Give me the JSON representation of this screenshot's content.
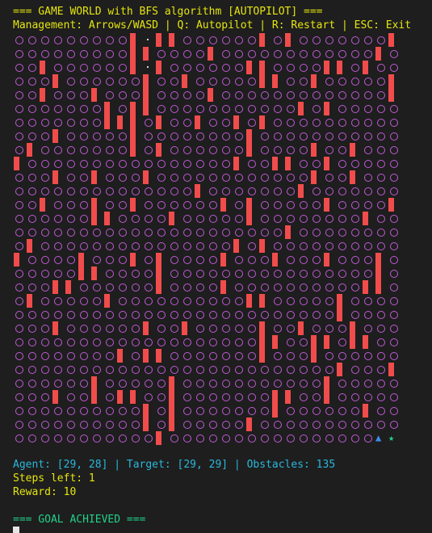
{
  "header": {
    "title": "=== GAME WORLD with BFS algorithm [AUTOPILOT] ===",
    "controls": "Management: Arrows/WASD | Q: Autopilot | R: Restart | ESC: Exit"
  },
  "grid": {
    "rows": 30,
    "cols": 30,
    "obstacles": [
      [
        0,
        9
      ],
      [
        0,
        11
      ],
      [
        0,
        12
      ],
      [
        0,
        19
      ],
      [
        0,
        21
      ],
      [
        0,
        29
      ],
      [
        1,
        9
      ],
      [
        1,
        10
      ],
      [
        1,
        15
      ],
      [
        1,
        28
      ],
      [
        2,
        2
      ],
      [
        2,
        9
      ],
      [
        2,
        11
      ],
      [
        2,
        18
      ],
      [
        2,
        19
      ],
      [
        2,
        24
      ],
      [
        2,
        25
      ],
      [
        2,
        27
      ],
      [
        3,
        3
      ],
      [
        3,
        10
      ],
      [
        3,
        13
      ],
      [
        3,
        19
      ],
      [
        3,
        20
      ],
      [
        3,
        23
      ],
      [
        3,
        29
      ],
      [
        4,
        2
      ],
      [
        4,
        6
      ],
      [
        4,
        10
      ],
      [
        4,
        15
      ],
      [
        4,
        29
      ],
      [
        5,
        7
      ],
      [
        5,
        9
      ],
      [
        5,
        10
      ],
      [
        5,
        22
      ],
      [
        5,
        24
      ],
      [
        6,
        7
      ],
      [
        6,
        8
      ],
      [
        6,
        9
      ],
      [
        6,
        11
      ],
      [
        6,
        14
      ],
      [
        6,
        17
      ],
      [
        6,
        19
      ],
      [
        7,
        3
      ],
      [
        7,
        9
      ],
      [
        7,
        18
      ],
      [
        8,
        1
      ],
      [
        8,
        9
      ],
      [
        8,
        11
      ],
      [
        8,
        18
      ],
      [
        8,
        23
      ],
      [
        8,
        26
      ],
      [
        9,
        0
      ],
      [
        9,
        17
      ],
      [
        9,
        20
      ],
      [
        9,
        21
      ],
      [
        9,
        24
      ],
      [
        10,
        3
      ],
      [
        10,
        6
      ],
      [
        10,
        10
      ],
      [
        10,
        23
      ],
      [
        10,
        26
      ],
      [
        11,
        14
      ],
      [
        11,
        22
      ],
      [
        12,
        2
      ],
      [
        12,
        6
      ],
      [
        12,
        9
      ],
      [
        12,
        16
      ],
      [
        12,
        18
      ],
      [
        12,
        24
      ],
      [
        12,
        29
      ],
      [
        13,
        6
      ],
      [
        13,
        7
      ],
      [
        13,
        12
      ],
      [
        13,
        18
      ],
      [
        13,
        27
      ],
      [
        14,
        21
      ],
      [
        15,
        1
      ],
      [
        15,
        17
      ],
      [
        15,
        19
      ],
      [
        16,
        0
      ],
      [
        16,
        5
      ],
      [
        16,
        9
      ],
      [
        16,
        11
      ],
      [
        16,
        16
      ],
      [
        16,
        20
      ],
      [
        16,
        24
      ],
      [
        16,
        28
      ],
      [
        17,
        5
      ],
      [
        17,
        6
      ],
      [
        17,
        11
      ],
      [
        17,
        28
      ],
      [
        18,
        3
      ],
      [
        18,
        4
      ],
      [
        18,
        11
      ],
      [
        18,
        16
      ],
      [
        18,
        27
      ],
      [
        18,
        28
      ],
      [
        19,
        1
      ],
      [
        19,
        7
      ],
      [
        19,
        18
      ],
      [
        19,
        19
      ],
      [
        19,
        25
      ],
      [
        20,
        25
      ],
      [
        21,
        3
      ],
      [
        21,
        10
      ],
      [
        21,
        13
      ],
      [
        21,
        19
      ],
      [
        21,
        22
      ],
      [
        21,
        26
      ],
      [
        22,
        19
      ],
      [
        22,
        20
      ],
      [
        22,
        23
      ],
      [
        22,
        24
      ],
      [
        22,
        26
      ],
      [
        22,
        27
      ],
      [
        23,
        8
      ],
      [
        23,
        10
      ],
      [
        23,
        11
      ],
      [
        23,
        19
      ],
      [
        23,
        23
      ],
      [
        24,
        25
      ],
      [
        24,
        29
      ],
      [
        25,
        6
      ],
      [
        25,
        12
      ],
      [
        25,
        24
      ],
      [
        26,
        3
      ],
      [
        26,
        6
      ],
      [
        26,
        8
      ],
      [
        26,
        9
      ],
      [
        26,
        12
      ],
      [
        26,
        20
      ],
      [
        26,
        21
      ],
      [
        26,
        24
      ],
      [
        27,
        10
      ],
      [
        27,
        12
      ],
      [
        27,
        20
      ],
      [
        27,
        27
      ],
      [
        28,
        10
      ],
      [
        28,
        12
      ],
      [
        28,
        18
      ],
      [
        29,
        11
      ]
    ],
    "path": [
      [
        0,
        10
      ],
      [
        1,
        10
      ],
      [
        2,
        10
      ]
    ],
    "agent": {
      "row": 29,
      "col": 28,
      "glyph": "▲"
    },
    "target": {
      "row": 29,
      "col": 29,
      "glyph": "★"
    }
  },
  "status": {
    "agent_target_line": "Agent: [29, 28] | Target: [29, 29] | Obstacles: 135",
    "steps_left": "Steps left: 1",
    "reward": "Reward: 10"
  },
  "result": {
    "message": "=== GOAL ACHIEVED ==="
  },
  "colors": {
    "background": "#1e1e1e",
    "header": "#e5e510",
    "empty_cell": "#c15bd6",
    "obstacle": "#f14c4c",
    "agent": "#3b8eea",
    "target": "#23d18b",
    "status": "#29b8db",
    "goal": "#23d18b"
  }
}
